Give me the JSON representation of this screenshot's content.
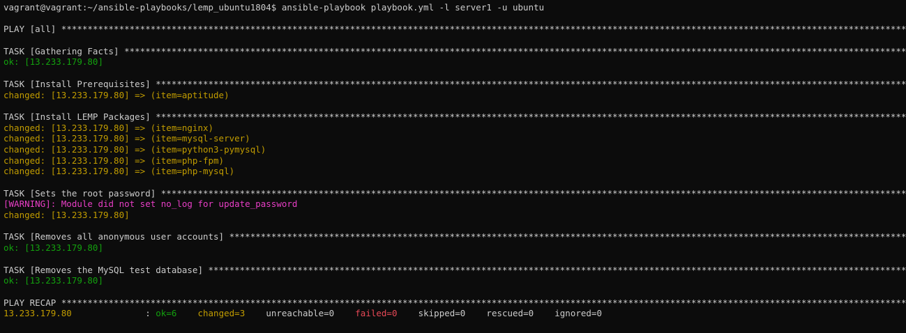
{
  "terminal": {
    "lines": [
      [
        {
          "text": "vagrant@vagrant:~/ansible-playbooks/lemp_ubuntu1804$ ansible-playbook playbook.yml -l server1 -u ubuntu",
          "color": "white"
        }
      ],
      [],
      [
        {
          "text": "PLAY [all] ",
          "color": "white"
        },
        {
          "fill": "*",
          "color": "white"
        }
      ],
      [],
      [
        {
          "text": "TASK [Gathering Facts] ",
          "color": "white"
        },
        {
          "fill": "*",
          "color": "white"
        }
      ],
      [
        {
          "text": "ok: [13.233.179.80]",
          "color": "green"
        }
      ],
      [],
      [
        {
          "text": "TASK [Install Prerequisites] ",
          "color": "white"
        },
        {
          "fill": "*",
          "color": "white"
        }
      ],
      [
        {
          "text": "changed: [13.233.179.80] => (item=aptitude)",
          "color": "yellow"
        }
      ],
      [],
      [
        {
          "text": "TASK [Install LEMP Packages] ",
          "color": "white"
        },
        {
          "fill": "*",
          "color": "white"
        }
      ],
      [
        {
          "text": "changed: [13.233.179.80] => (item=nginx)",
          "color": "yellow"
        }
      ],
      [
        {
          "text": "changed: [13.233.179.80] => (item=mysql-server)",
          "color": "yellow"
        }
      ],
      [
        {
          "text": "changed: [13.233.179.80] => (item=python3-pymysql)",
          "color": "yellow"
        }
      ],
      [
        {
          "text": "changed: [13.233.179.80] => (item=php-fpm)",
          "color": "yellow"
        }
      ],
      [
        {
          "text": "changed: [13.233.179.80] => (item=php-mysql)",
          "color": "yellow"
        }
      ],
      [],
      [
        {
          "text": "TASK [Sets the root password] ",
          "color": "white"
        },
        {
          "fill": "*",
          "color": "white"
        }
      ],
      [
        {
          "text": "[WARNING]: Module did not set no_log for update_password",
          "color": "pink"
        }
      ],
      [
        {
          "text": "changed: [13.233.179.80]",
          "color": "yellow"
        }
      ],
      [],
      [
        {
          "text": "TASK [Removes all anonymous user accounts] ",
          "color": "white"
        },
        {
          "fill": "*",
          "color": "white"
        }
      ],
      [
        {
          "text": "ok: [13.233.179.80]",
          "color": "green"
        }
      ],
      [],
      [
        {
          "text": "TASK [Removes the MySQL test database] ",
          "color": "white"
        },
        {
          "fill": "*",
          "color": "white"
        }
      ],
      [
        {
          "text": "ok: [13.233.179.80]",
          "color": "green"
        }
      ],
      [],
      [
        {
          "text": "PLAY RECAP ",
          "color": "white"
        },
        {
          "fill": "*",
          "color": "white"
        }
      ],
      [
        {
          "text": "13.233.179.80",
          "color": "yellow"
        },
        {
          "text": "              : ",
          "color": "white"
        },
        {
          "text": "ok=6",
          "color": "green"
        },
        {
          "text": "    ",
          "color": "white"
        },
        {
          "text": "changed=3",
          "color": "yellow"
        },
        {
          "text": "    unreachable=0    ",
          "color": "white"
        },
        {
          "text": "failed=0",
          "color": "red"
        },
        {
          "text": "    skipped=0    rescued=0    ignored=0",
          "color": "white"
        }
      ]
    ]
  },
  "colors": {
    "background": "#0c0c0c",
    "white": "#cccccc",
    "green": "#13a10e",
    "yellow": "#c19c00",
    "pink": "#e83ec6",
    "red": "#e74856"
  }
}
